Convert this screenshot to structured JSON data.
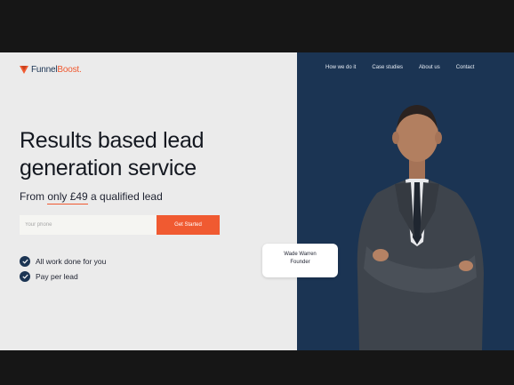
{
  "brand": {
    "name_main": "Funnel",
    "name_accent": "Boost",
    "dot": ".",
    "accent_color": "#f05a31",
    "navy_color": "#1b3453"
  },
  "nav": {
    "items": [
      {
        "label": "How we do it"
      },
      {
        "label": "Case studies"
      },
      {
        "label": "About us"
      },
      {
        "label": "Contact"
      }
    ]
  },
  "hero": {
    "title_line1": "Results based lead",
    "title_line2": "generation service",
    "sub_prefix": "From ",
    "sub_highlight": "only £49",
    "sub_suffix": " a qualified lead"
  },
  "form": {
    "phone_placeholder": "Your phone",
    "phone_value": "",
    "cta_label": "Get Started"
  },
  "features": [
    {
      "label": "All work done for you",
      "icon": "check-icon"
    },
    {
      "label": "Pay per lead",
      "icon": "check-icon"
    }
  ],
  "profile": {
    "name": "Wade Warren",
    "role": "Founder"
  }
}
